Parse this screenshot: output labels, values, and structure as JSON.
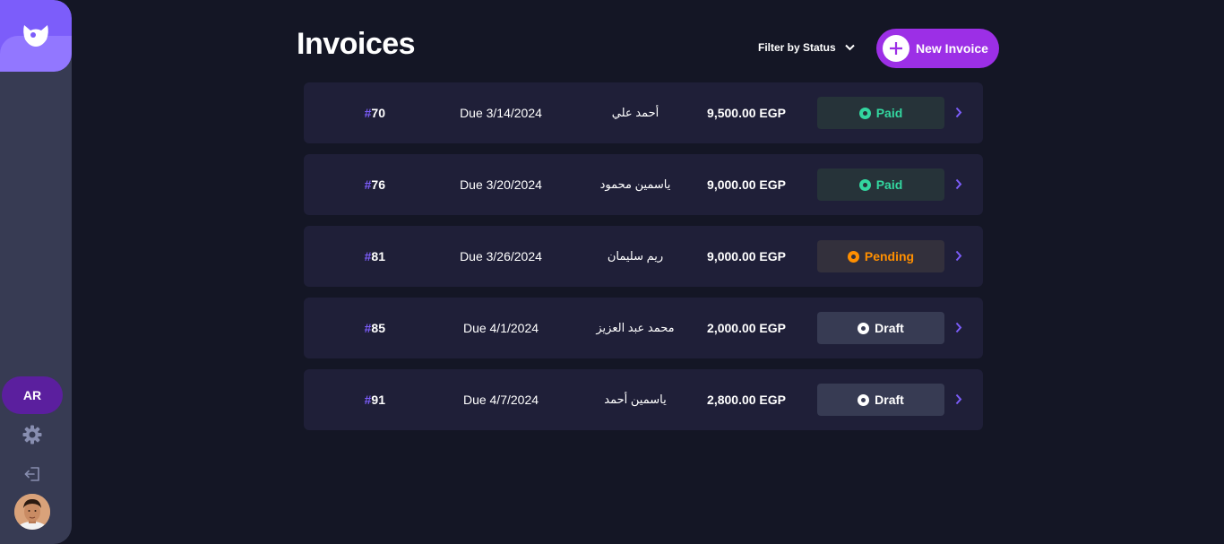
{
  "sidebar": {
    "logo_icon": "app-logo-icon",
    "lang_label": "AR",
    "settings_icon": "gear-icon",
    "logout_icon": "logout-icon",
    "avatar_icon": "user-avatar"
  },
  "header": {
    "title": "Invoices",
    "filter_label": "Filter by Status",
    "new_button_label": "New Invoice"
  },
  "colors": {
    "accent": "#9c2fe6",
    "paid": "#33d69f",
    "pending": "#ff8f00",
    "draft": "#ffffff",
    "background": "#141625",
    "card": "#1f1f38"
  },
  "invoices": [
    {
      "hash": "#",
      "id": "70",
      "due": "Due 3/14/2024",
      "client": "أحمد علي",
      "amount": "9,500.00 EGP",
      "status": "Paid",
      "status_type": "paid"
    },
    {
      "hash": "#",
      "id": "76",
      "due": "Due 3/20/2024",
      "client": "ياسمين محمود",
      "amount": "9,000.00 EGP",
      "status": "Paid",
      "status_type": "paid"
    },
    {
      "hash": "#",
      "id": "81",
      "due": "Due 3/26/2024",
      "client": "ريم سليمان",
      "amount": "9,000.00 EGP",
      "status": "Pending",
      "status_type": "pending"
    },
    {
      "hash": "#",
      "id": "85",
      "due": "Due 4/1/2024",
      "client": "محمد عبد العزيز",
      "amount": "2,000.00 EGP",
      "status": "Draft",
      "status_type": "draft"
    },
    {
      "hash": "#",
      "id": "91",
      "due": "Due 4/7/2024",
      "client": "ياسمين أحمد",
      "amount": "2,800.00 EGP",
      "status": "Draft",
      "status_type": "draft"
    }
  ]
}
